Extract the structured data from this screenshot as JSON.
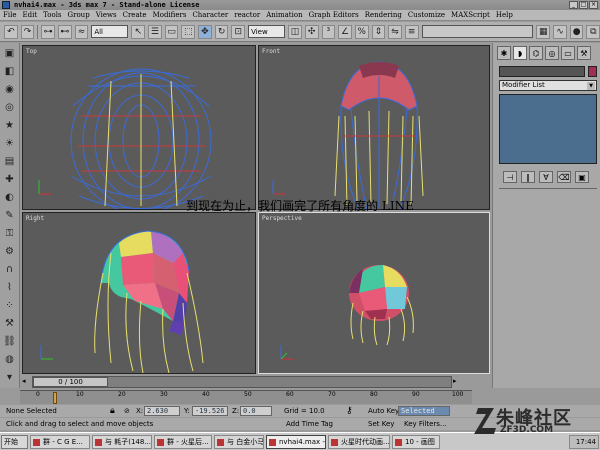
{
  "window": {
    "title": "nvhai4.max - 3ds max 7 - Stand-alone License"
  },
  "menu": [
    "File",
    "Edit",
    "Tools",
    "Group",
    "Views",
    "Create",
    "Modifiers",
    "Character",
    "reactor",
    "Animation",
    "Graph Editors",
    "Rendering",
    "Customize",
    "MAXScript",
    "Help"
  ],
  "toolbar": {
    "selection_filter": "All",
    "ref_coord": "View",
    "named_selection": ""
  },
  "viewports": {
    "top_label": "Top",
    "front_label": "Front",
    "right_label": "Right",
    "perspective_label": "Perspective"
  },
  "caption": "到现在为止，我们画完了所有角度的 LINE",
  "command_panel": {
    "modifier_list": "Modifier List"
  },
  "time_slider": {
    "frame": "0 / 100"
  },
  "track_labels": [
    "0",
    "10",
    "20",
    "30",
    "40",
    "50",
    "60",
    "70",
    "80",
    "90",
    "100"
  ],
  "status": {
    "selection": "None Selected",
    "prompt": "Click and drag to select and move objects",
    "x_label": "X:",
    "x_value": "2.630",
    "y_label": "Y:",
    "y_value": "-19.526",
    "z_label": "Z:",
    "z_value": "0.0",
    "grid": "Grid = 10.0",
    "add_time_tag": "Add Time Tag",
    "auto_key": "Auto Key",
    "auto_key_mode": "Selected",
    "set_key": "Set Key",
    "key_filters": "Key Filters..."
  },
  "taskbar": {
    "start": "开始",
    "tasks": [
      "群 - C G E...",
      "与 耗子(148...",
      "群 - 火星后...",
      "与 白金小马",
      "nvhai4.max -...",
      "火星时代动画...",
      "10 - 画图"
    ],
    "clock": "17:44"
  },
  "watermark": {
    "text": "朱峰社区",
    "url": "ZF3D.COM"
  },
  "colors": {
    "viewport_bg": "#5b5b5b",
    "wire_blue": "#3a6bd8",
    "wire_red": "#c83838",
    "wire_yellow": "#e8e070",
    "accent_active": "#8fb0d8"
  }
}
